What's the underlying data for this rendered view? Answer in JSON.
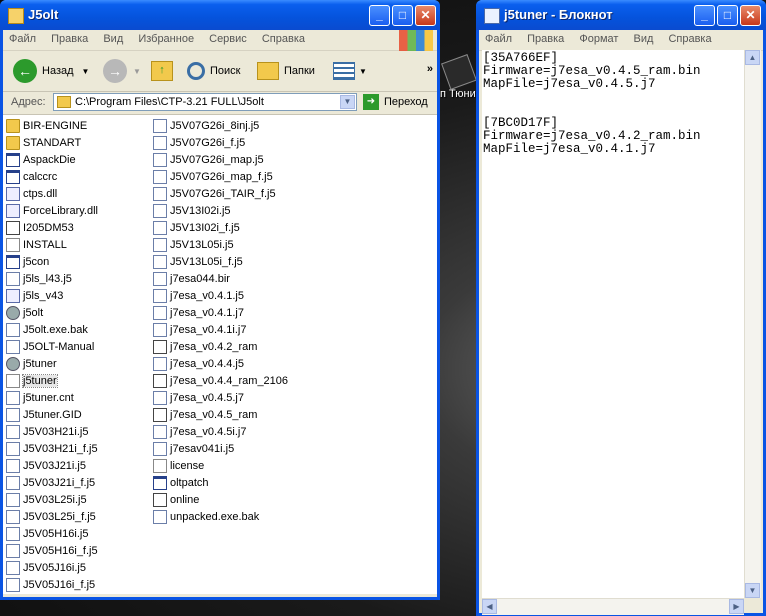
{
  "desktop": {
    "icon_label": "п Тюни"
  },
  "explorer": {
    "title": "J5olt",
    "menu": [
      "Файл",
      "Правка",
      "Вид",
      "Избранное",
      "Сервис",
      "Справка"
    ],
    "toolbar": {
      "back_label": "Назад",
      "search_label": "Поиск",
      "folders_label": "Папки"
    },
    "address_label": "Адрес:",
    "address_value": "C:\\Program Files\\CTP-3.21 FULL\\J5olt",
    "go_label": "Переход",
    "column1": [
      {
        "name": "BIR-ENGINE",
        "icon": "folder-icon"
      },
      {
        "name": "STANDART",
        "icon": "folder-icon"
      },
      {
        "name": "AspackDie",
        "icon": "app-icon"
      },
      {
        "name": "calccrc",
        "icon": "app-icon"
      },
      {
        "name": "ctps.dll",
        "icon": "dll-icon"
      },
      {
        "name": "ForceLibrary.dll",
        "icon": "dll-icon"
      },
      {
        "name": "I205DM53",
        "icon": "ini-icon"
      },
      {
        "name": "INSTALL",
        "icon": "text-icon"
      },
      {
        "name": "j5con",
        "icon": "app-icon"
      },
      {
        "name": "j5ls_l43.j5",
        "icon": "file-icon"
      },
      {
        "name": "j5ls_v43",
        "icon": "dll-icon"
      },
      {
        "name": "j5olt",
        "icon": "gear-icon"
      },
      {
        "name": "J5olt.exe.bak",
        "icon": "file-icon"
      },
      {
        "name": "J5OLT-Manual",
        "icon": "file-icon"
      },
      {
        "name": "j5tuner",
        "icon": "gear-icon"
      },
      {
        "name": "j5tuner",
        "icon": "text-icon",
        "selected": true
      },
      {
        "name": "j5tuner.cnt",
        "icon": "file-icon"
      },
      {
        "name": "J5tuner.GID",
        "icon": "file-icon"
      },
      {
        "name": "J5V03H21i.j5",
        "icon": "file-icon"
      },
      {
        "name": "J5V03H21i_f.j5",
        "icon": "file-icon"
      },
      {
        "name": "J5V03J21i.j5",
        "icon": "file-icon"
      },
      {
        "name": "J5V03J21i_f.j5",
        "icon": "file-icon"
      },
      {
        "name": "J5V03L25i.j5",
        "icon": "file-icon"
      },
      {
        "name": "J5V03L25i_f.j5",
        "icon": "file-icon"
      },
      {
        "name": "J5V05H16i.j5",
        "icon": "file-icon"
      },
      {
        "name": "J5V05H16i_f.j5",
        "icon": "file-icon"
      },
      {
        "name": "J5V05J16i.j5",
        "icon": "file-icon"
      },
      {
        "name": "J5V05J16i_f.j5",
        "icon": "file-icon"
      }
    ],
    "column2": [
      {
        "name": "J5V07G26i_8inj.j5",
        "icon": "file-icon"
      },
      {
        "name": "J5V07G26i_f.j5",
        "icon": "file-icon"
      },
      {
        "name": "J5V07G26i_map.j5",
        "icon": "file-icon"
      },
      {
        "name": "J5V07G26i_map_f.j5",
        "icon": "file-icon"
      },
      {
        "name": "J5V07G26i_TAIR_f.j5",
        "icon": "file-icon"
      },
      {
        "name": "J5V13I02i.j5",
        "icon": "file-icon"
      },
      {
        "name": "J5V13I02i_f.j5",
        "icon": "file-icon"
      },
      {
        "name": "J5V13L05i.j5",
        "icon": "file-icon"
      },
      {
        "name": "J5V13L05i_f.j5",
        "icon": "file-icon"
      },
      {
        "name": "j7esa044.bir",
        "icon": "file-icon"
      },
      {
        "name": "j7esa_v0.4.1.j5",
        "icon": "file-icon"
      },
      {
        "name": "j7esa_v0.4.1.j7",
        "icon": "file-icon"
      },
      {
        "name": "j7esa_v0.4.1i.j7",
        "icon": "file-icon"
      },
      {
        "name": "j7esa_v0.4.2_ram",
        "icon": "ini-icon"
      },
      {
        "name": "j7esa_v0.4.4.j5",
        "icon": "file-icon"
      },
      {
        "name": "j7esa_v0.4.4_ram_2106",
        "icon": "ini-icon"
      },
      {
        "name": "j7esa_v0.4.5.j7",
        "icon": "file-icon"
      },
      {
        "name": "j7esa_v0.4.5_ram",
        "icon": "ini-icon"
      },
      {
        "name": "j7esa_v0.4.5i.j7",
        "icon": "file-icon"
      },
      {
        "name": "j7esav041i.j5",
        "icon": "file-icon"
      },
      {
        "name": "license",
        "icon": "text-icon"
      },
      {
        "name": "oltpatch",
        "icon": "app-icon"
      },
      {
        "name": "online",
        "icon": "ini-icon"
      },
      {
        "name": "unpacked.exe.bak",
        "icon": "file-icon"
      }
    ]
  },
  "notepad": {
    "title": "j5tuner - Блокнот",
    "menu": [
      "Файл",
      "Правка",
      "Формат",
      "Вид",
      "Справка"
    ],
    "text": "[35A766EF]\nFirmware=j7esa_v0.4.5_ram.bin\nMapFile=j7esa_v0.4.5.j7\n\n\n[7BC0D17F]\nFirmware=j7esa_v0.4.2_ram.bin\nMapFile=j7esa_v0.4.1.j7"
  }
}
